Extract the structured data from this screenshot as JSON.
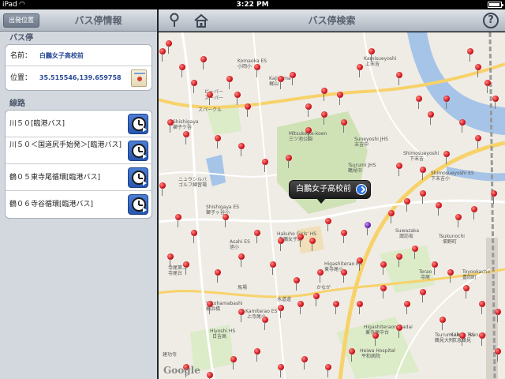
{
  "status_bar": {
    "carrier": "iPad",
    "time": "3:22 PM"
  },
  "left": {
    "back_button": "出発位置",
    "title": "バス停情報",
    "stop_section": "バス停",
    "name_label": "名前：",
    "name_value": "白鵬女子高校前",
    "position_label": "位置：",
    "position_value": "35.515546,139.659758",
    "routes_section": "線路",
    "routes": [
      {
        "label": "川５０[臨港バス]"
      },
      {
        "label": "川５０＜国道尻手始発＞[臨港バス]"
      },
      {
        "label": "鶴０５東寺尾循環[臨港バス]"
      },
      {
        "label": "鶴０６寺谷循環[臨港バス]"
      }
    ]
  },
  "right": {
    "title": "バス停検索",
    "help": "?",
    "callout": "白鵬女子高校前",
    "google": "Google"
  },
  "map_labels": [
    "Komaoka ES",
    "小岡小",
    "Kajiyama",
    "梶山",
    "ビーバー",
    "スーパー",
    "Shishigaya",
    "獅子ケ谷",
    "スパークル",
    "Kamisueyoshi",
    "上末吉",
    "Mitsukeike-koen",
    "三ツ池公園",
    "Terao JHS",
    "寺尾中",
    "Suneyoshi JHS",
    "末吉中",
    "Shimosueyoshi",
    "下末吉",
    "Shishigaya ES",
    "獅子ヶ谷小",
    "ニュウシルバ",
    "ゴルフ練習場",
    "Hakuho Girls' HS",
    "白鵬女子高",
    "Asahi ES",
    "旭小",
    "Suwazaka",
    "諏訪坂",
    "Tsukunochi",
    "佃野町",
    "Tsurumi JHS",
    "鶴見中",
    "寺尾第二",
    "寺尾台",
    "Higashiterao ES",
    "東寺尾小",
    "Terao",
    "寺尾",
    "Yokohamabashi",
    "横浜橋",
    "Kamiterao ES",
    "上寺尾小",
    "Hiyoshi HS",
    "日吉高",
    "Higashiteraonakadai",
    "東寺尾中台",
    "Tsurumi Univ. HS",
    "鶴見大附",
    "Keikyu Tsurumi",
    "京急鶴見",
    "Toyookacho",
    "豊岡町",
    "馬場",
    "建功寺",
    "水道道",
    "かなが",
    "Heiwa Hospital",
    "平和病院",
    "Shimosueyoshi ES",
    "下末吉小"
  ]
}
